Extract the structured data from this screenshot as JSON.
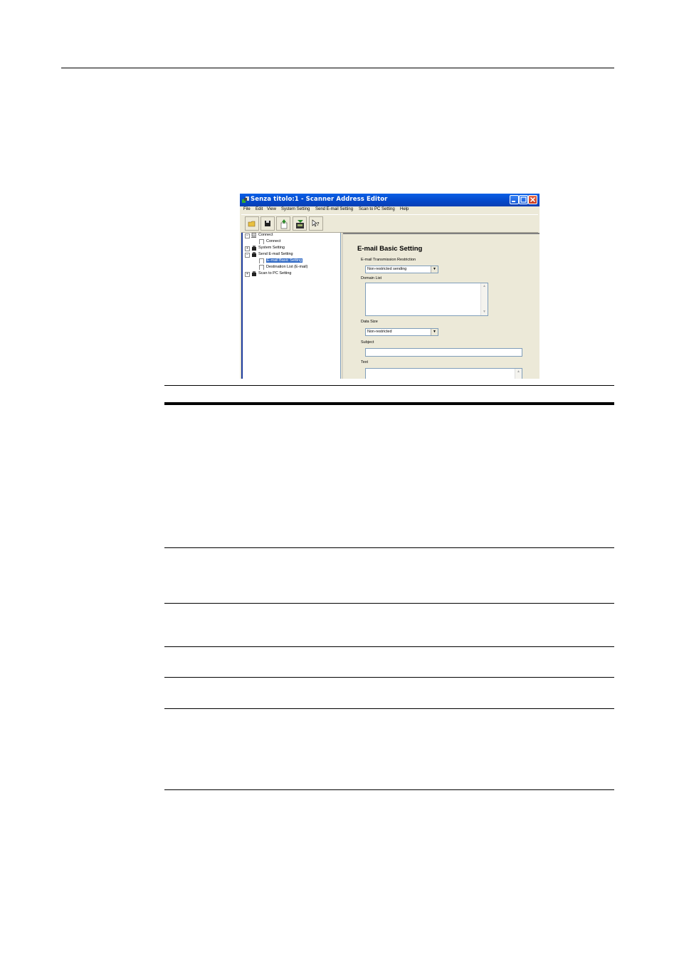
{
  "window": {
    "title": "Senza titolo:1 - Scanner Address Editor",
    "menu": [
      "File",
      "Edit",
      "View",
      "System Setting",
      "Send E-mail Setting",
      "Scan to PC Setting",
      "Help"
    ]
  },
  "toolbar": {
    "buttons": [
      "open-icon",
      "save-icon",
      "send-icon",
      "receive-icon",
      "help-icon"
    ]
  },
  "tree": {
    "connect": "Connect",
    "connect_child": "Connect",
    "system_setting": "System Setting",
    "send_email_setting": "Send E-mail Setting",
    "email_basic_setting": "E-mail Basic Setting",
    "destination_list": "Destination List (E-mail)",
    "scan_to_pc": "Scan to PC Setting"
  },
  "form": {
    "heading": "E-mail Basic Setting",
    "restriction_label": "E-mail Transmission Restriction",
    "restriction_value": "Non-restricted sending",
    "domain_label": "Domain List",
    "data_size_label": "Data Size",
    "data_size_value": "Non-restricted",
    "subject_label": "Subject",
    "text_label": "Text"
  },
  "colors": {
    "titlebar": "#0447c8",
    "selection": "#316ac5",
    "window_bg": "#ece9d8"
  }
}
